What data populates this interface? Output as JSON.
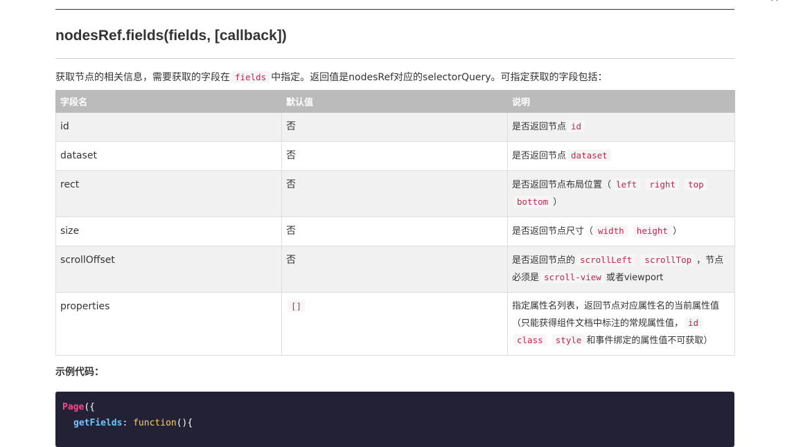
{
  "corner_snippet": "（ ） ",
  "title": "nodesRef.fields(fields, [callback])",
  "intro": {
    "before": "获取节点的相关信息，需要获取的字段在",
    "code": "fields",
    "after": "中指定。返回值是nodesRef对应的selectorQuery。可指定获取的字段包括："
  },
  "table": {
    "headers": {
      "field": "字段名",
      "default": "默认值",
      "desc": "说明"
    },
    "rows": {
      "id": {
        "field": "id",
        "default": "否",
        "desc_pre": "是否返回节点",
        "c1": "id"
      },
      "dataset": {
        "field": "dataset",
        "default": "否",
        "desc_pre": "是否返回节点",
        "c1": "dataset"
      },
      "rect": {
        "field": "rect",
        "default": "否",
        "desc_pre": "是否返回节点布局位置（",
        "c1": "left",
        "c2": "right",
        "c3": "top",
        "c4": "bottom",
        "desc_post": "）"
      },
      "size": {
        "field": "size",
        "default": "否",
        "desc_pre": "是否返回节点尺寸（",
        "c1": "width",
        "c2": "height",
        "desc_post": "）"
      },
      "scrollOffset": {
        "field": "scrollOffset",
        "default": "否",
        "desc_pre": "是否返回节点的",
        "c1": "scrollLeft",
        "c2": "scrollTop",
        "desc_mid": "，节点必须是",
        "c3": "scroll-view",
        "desc_post": "或者viewport"
      },
      "properties": {
        "field": "properties",
        "default_code": "[]",
        "desc_pre": "指定属性名列表，返回节点对应属性名的当前属性值（只能获得组件文档中标注的常规属性值，",
        "c1": "id",
        "c2": "class",
        "c3": "style",
        "desc_post": "和事件绑定的属性值不可获取）"
      }
    }
  },
  "example_label": "示例代码：",
  "code": {
    "line1_name": "Page",
    "line1_punc": "({",
    "line2_prop": "getFields",
    "line2_colon": ": ",
    "line2_fn": "function",
    "line2_punc": "(){"
  }
}
